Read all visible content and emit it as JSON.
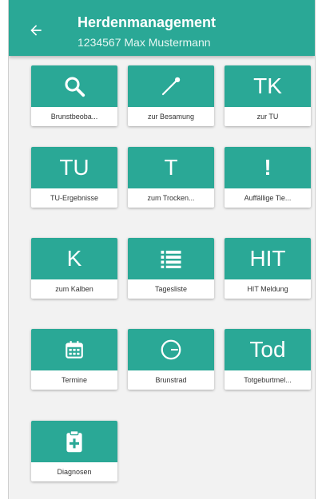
{
  "header": {
    "back_icon": "arrow-left-icon",
    "title": "Herdenmanagement",
    "subtitle": "1234567 Max Mustermann"
  },
  "tiles": [
    {
      "label": "Brunstbeoba...",
      "icon": "search-icon"
    },
    {
      "label": "zur Besamung",
      "icon": "insemination-icon"
    },
    {
      "label": "zur TU",
      "glyph": "TK"
    },
    {
      "label": "TU-Ergebnisse",
      "glyph": "TU"
    },
    {
      "label": "zum Trocken...",
      "glyph": "T"
    },
    {
      "label": "Auffällige Tie...",
      "glyph": "!"
    },
    {
      "label": "zum Kalben",
      "glyph": "K"
    },
    {
      "label": "Tagesliste",
      "icon": "list-icon"
    },
    {
      "label": "HIT Meldung",
      "glyph": "HIT"
    },
    {
      "label": "Termine",
      "icon": "calendar-icon"
    },
    {
      "label": "Brunstrad",
      "icon": "circle-minus-icon"
    },
    {
      "label": "Totgeburtmel...",
      "glyph": "Tod"
    },
    {
      "label": "Diagnosen",
      "icon": "clipboard-plus-icon"
    }
  ],
  "colors": {
    "accent": "#2aa896",
    "background": "#f2f2f2"
  }
}
